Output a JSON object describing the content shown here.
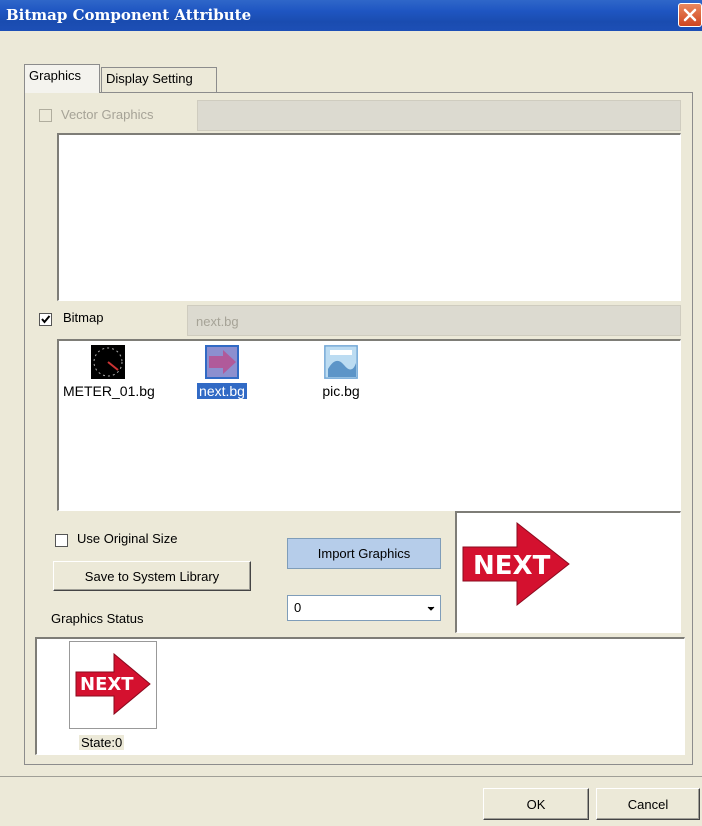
{
  "window": {
    "title": "Bitmap Component Attribute"
  },
  "tabs": [
    {
      "label": "Graphics",
      "active": true
    },
    {
      "label": "Display Setting",
      "active": false
    }
  ],
  "vector_graphics": {
    "label": "Vector Graphics",
    "checked": false,
    "enabled": false,
    "value": ""
  },
  "bitmap": {
    "label": "Bitmap",
    "checked": true,
    "value": "next.bg",
    "files": [
      {
        "name": "METER_01.bg",
        "icon": "meter-thumbnail-icon",
        "selected": false
      },
      {
        "name": "next.bg",
        "icon": "next-arrow-thumbnail-icon",
        "selected": true
      },
      {
        "name": "pic.bg",
        "icon": "picture-thumbnail-icon",
        "selected": false
      }
    ]
  },
  "options": {
    "use_original_size_label": "Use Original Size",
    "use_original_size_checked": false,
    "save_to_library_label": "Save to System Library",
    "import_graphics_label": "Import Graphics"
  },
  "preview": {
    "image_text": "NEXT"
  },
  "graphics_status": {
    "label": "Graphics Status",
    "selected_state": "0",
    "states": [
      {
        "image_text": "NEXT",
        "caption": "State:0"
      }
    ]
  },
  "footer": {
    "ok_label": "OK",
    "cancel_label": "Cancel"
  },
  "colors": {
    "title_bar": "#1f56c2",
    "arrow_red": "#d4112f",
    "selection_blue": "#316ac5"
  }
}
